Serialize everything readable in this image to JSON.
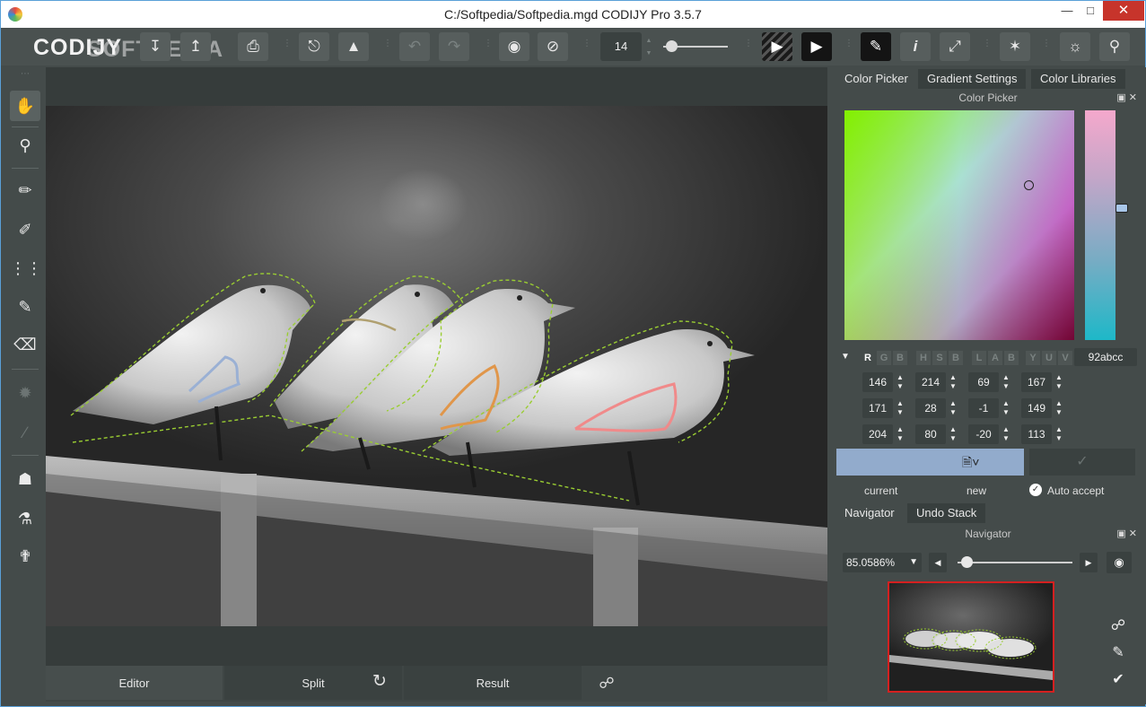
{
  "window": {
    "title": "C:/Softpedia/Softpedia.mgd CODIJY Pro 3.5.7",
    "min": "▭",
    "max": "▭",
    "close": "✕"
  },
  "toolbar": {
    "logo": "CODIJY",
    "watermark": "SOFTPEDIA",
    "brush_size": "14",
    "icons": [
      "import-icon",
      "export-icon",
      "print-icon",
      "colorize-icon",
      "fill-icon",
      "undo-icon",
      "redo-icon",
      "eye-icon",
      "eye-crossed-icon",
      "play-striped-icon",
      "play-icon",
      "pen-icon",
      "info-icon",
      "expand-icon",
      "star-icon",
      "bug-icon",
      "tool-icon"
    ]
  },
  "left_tools": [
    "hand-icon",
    "zoom-icon",
    "brush-icon",
    "pencil-icon",
    "dotted-brush-icon",
    "marker-icon",
    "eraser-icon",
    "blend-icon",
    "smudge-icon",
    "bucket-icon",
    "stamp-icon",
    "eyedropper-icon"
  ],
  "bottom_tabs": {
    "editor": "Editor",
    "split": "Split",
    "result": "Result"
  },
  "right_panel": {
    "tabs": [
      "Color Picker",
      "Gradient Settings",
      "Color Libraries"
    ],
    "color_picker_title": "Color Picker",
    "modes": [
      "R",
      "G",
      "B",
      "H",
      "S",
      "B",
      "L",
      "A",
      "B",
      "Y",
      "U",
      "V"
    ],
    "hex": "92abcc",
    "values": [
      [
        "146",
        "214",
        "69",
        "167"
      ],
      [
        "171",
        "28",
        "-1",
        "149"
      ],
      [
        "204",
        "80",
        "-20",
        "113"
      ]
    ],
    "current_label": "current",
    "new_label": "new",
    "auto_accept": "Auto accept",
    "current_color": "#92abcc",
    "nav_tabs": [
      "Navigator",
      "Undo Stack"
    ],
    "navigator_title": "Navigator",
    "zoom": "85.0586%"
  }
}
